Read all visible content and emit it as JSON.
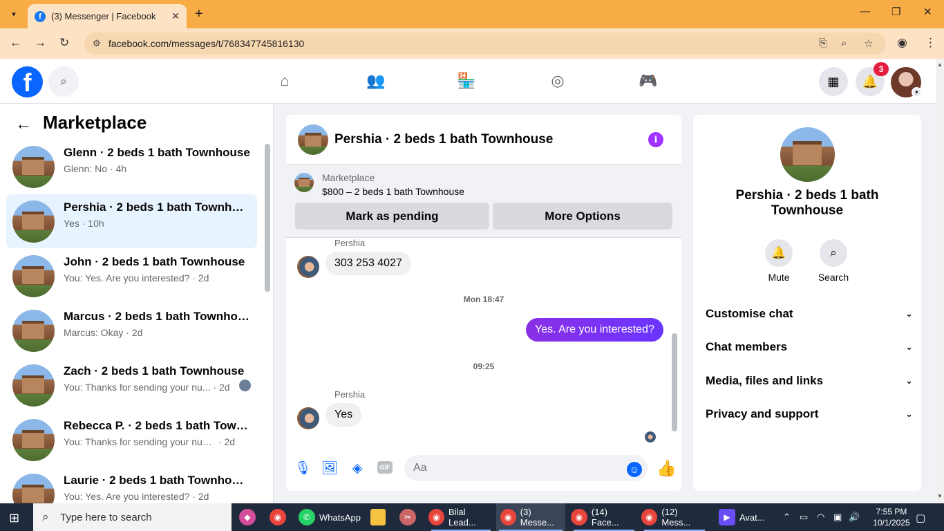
{
  "browser": {
    "tab_title": "(3) Messenger | Facebook",
    "url": "facebook.com/messages/t/768347745816130"
  },
  "fb": {
    "notification_count": "3"
  },
  "left": {
    "title": "Marketplace",
    "conversations": [
      {
        "name": "Glenn · 2 beds 1 bath Townhouse",
        "snippet": "Glenn: No",
        "time": "4h",
        "active": false
      },
      {
        "name": "Pershia · 2 beds 1 bath Townhouse",
        "snippet": "Yes",
        "time": "10h",
        "active": true
      },
      {
        "name": "John · 2 beds 1 bath Townhouse",
        "snippet": "You: Yes. Are you interested?",
        "time": "2d",
        "active": false
      },
      {
        "name": "Marcus · 2 beds 1 bath Townhouse",
        "snippet": "Marcus: Okay",
        "time": "2d",
        "active": false
      },
      {
        "name": "Zach · 2 beds 1 bath Townhouse",
        "snippet": "You: Thanks for sending your nu...",
        "time": "2d",
        "active": false
      },
      {
        "name": "Rebecca P. · 2 beds 1 bath Townh...",
        "snippet": "You: Thanks for sending your numb...",
        "time": "2d",
        "active": false
      },
      {
        "name": "Laurie · 2 beds 1 bath Townhouse",
        "snippet": "You: Yes. Are you interested?",
        "time": "2d",
        "active": false
      }
    ]
  },
  "chat": {
    "title": "Pershia · 2 beds 1 bath Townhouse",
    "marketplace_label": "Marketplace",
    "listing": "$800 – 2 beds 1 bath Townhouse",
    "mark_pending": "Mark as pending",
    "more_options": "More Options",
    "sender1": "Pershia",
    "msg1": "303 253 4027",
    "stamp1": "Mon 18:47",
    "msg_out": "Yes. Are you interested?",
    "stamp2": "09:25",
    "sender2": "Pershia",
    "msg2": "Yes",
    "input_placeholder": "Aa"
  },
  "right": {
    "title": "Pershia · 2 beds 1 bath Townhouse",
    "mute": "Mute",
    "search": "Search",
    "rows": [
      "Customise chat",
      "Chat members",
      "Media, files and links",
      "Privacy and support"
    ]
  },
  "taskbar": {
    "search_placeholder": "Type here to search",
    "apps": [
      {
        "label": "WhatsApp"
      },
      {
        "label": "Bilal Lead..."
      },
      {
        "label": "(3) Messe..."
      },
      {
        "label": "(14) Face..."
      },
      {
        "label": "(12) Mess..."
      },
      {
        "label": "Avat..."
      }
    ],
    "time": "7:55 PM",
    "date": "10/1/2025"
  }
}
